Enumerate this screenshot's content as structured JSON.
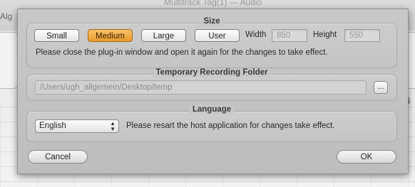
{
  "host": {
    "title": "Multitrack Tag(1) — Audio",
    "tab": "Alg",
    "side_text": "4"
  },
  "size": {
    "title": "Size",
    "buttons": [
      {
        "label": "Small",
        "active": false
      },
      {
        "label": "Medium",
        "active": true
      },
      {
        "label": "Large",
        "active": false
      },
      {
        "label": "User",
        "active": false
      }
    ],
    "width_label": "Width",
    "width_value": "850",
    "height_label": "Height",
    "height_value": "550",
    "note": "Please close the plug-in window and open it again for the changes to take effect."
  },
  "temp": {
    "title": "Temporary Recording Folder",
    "path": "/Users/ugh_allgemein/Desktop/temp",
    "browse_label": "..."
  },
  "language": {
    "title": "Language",
    "selected": "English",
    "note": "Please resart the host application for changes take effect."
  },
  "footer": {
    "cancel_label": "Cancel",
    "ok_label": "OK"
  },
  "colors": {
    "accent": "#f0ad45",
    "sheet": "#c4c4c4"
  }
}
